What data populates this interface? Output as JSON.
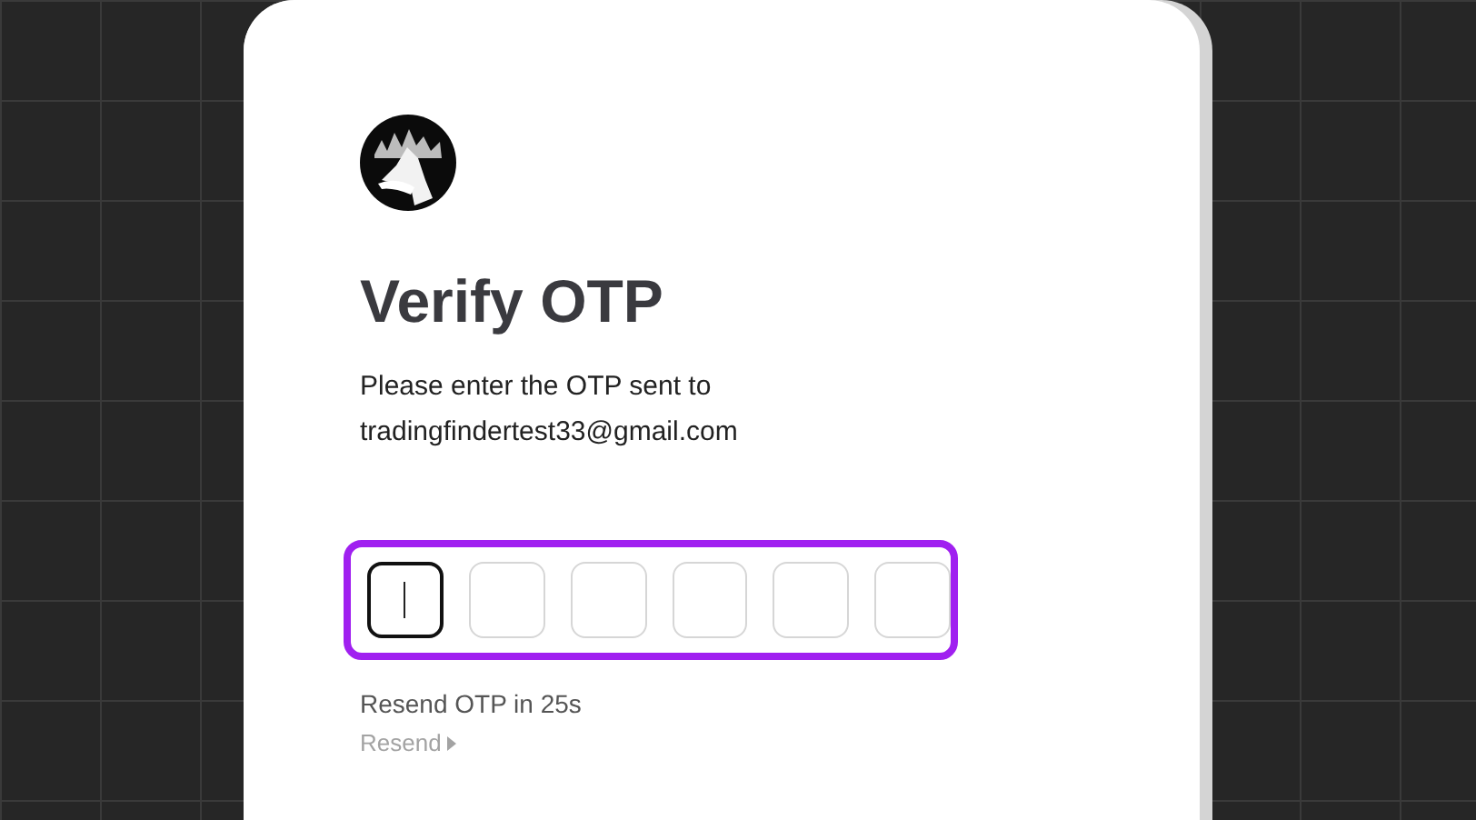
{
  "card": {
    "title": "Verify OTP",
    "message": "Please enter the OTP sent to",
    "email": "tradingfindertest33@gmail.com"
  },
  "otp": {
    "cells": [
      {
        "focused": true
      },
      {
        "focused": false
      },
      {
        "focused": false
      },
      {
        "focused": false
      },
      {
        "focused": false
      },
      {
        "focused": false
      }
    ],
    "highlighted": true
  },
  "resend": {
    "countdown": "Resend OTP in 25s",
    "link": "Resend",
    "disabled": true
  }
}
